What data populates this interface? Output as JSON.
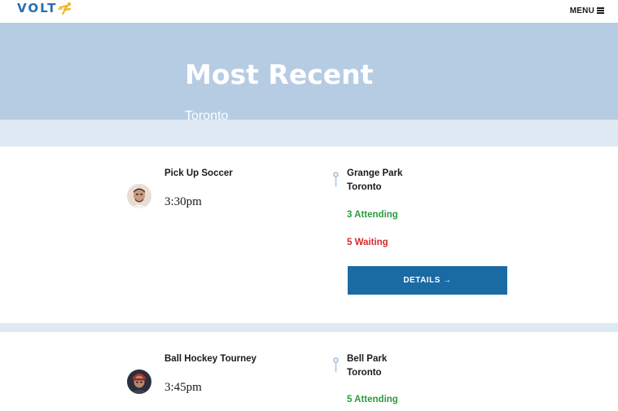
{
  "nav": {
    "logo_text": "VOLT",
    "logo_icon": "runner-bolt-icon",
    "menu_label": "MENU",
    "menu_icon": "hamburger-icon"
  },
  "hero": {
    "title": "Most Recent",
    "subtitle": "Toronto"
  },
  "events": [
    {
      "title": "Pick Up Soccer",
      "time": "3:30pm",
      "location_name": "Grange Park",
      "location_city": "Toronto",
      "attending": "3 Attending",
      "waiting": "5 Waiting",
      "details_label": "DETAILS →"
    },
    {
      "title": "Ball Hockey Tourney",
      "time": "3:45pm",
      "location_name": "Bell Park",
      "location_city": "Toronto",
      "attending": "5 Attending"
    }
  ],
  "colors": {
    "hero_bg": "#b6cce3",
    "band_bg": "#dfe9f3",
    "attending": "#2e9c3d",
    "waiting": "#d52b2b",
    "button": "#1a6aa4",
    "logo": "#2a6db0"
  }
}
